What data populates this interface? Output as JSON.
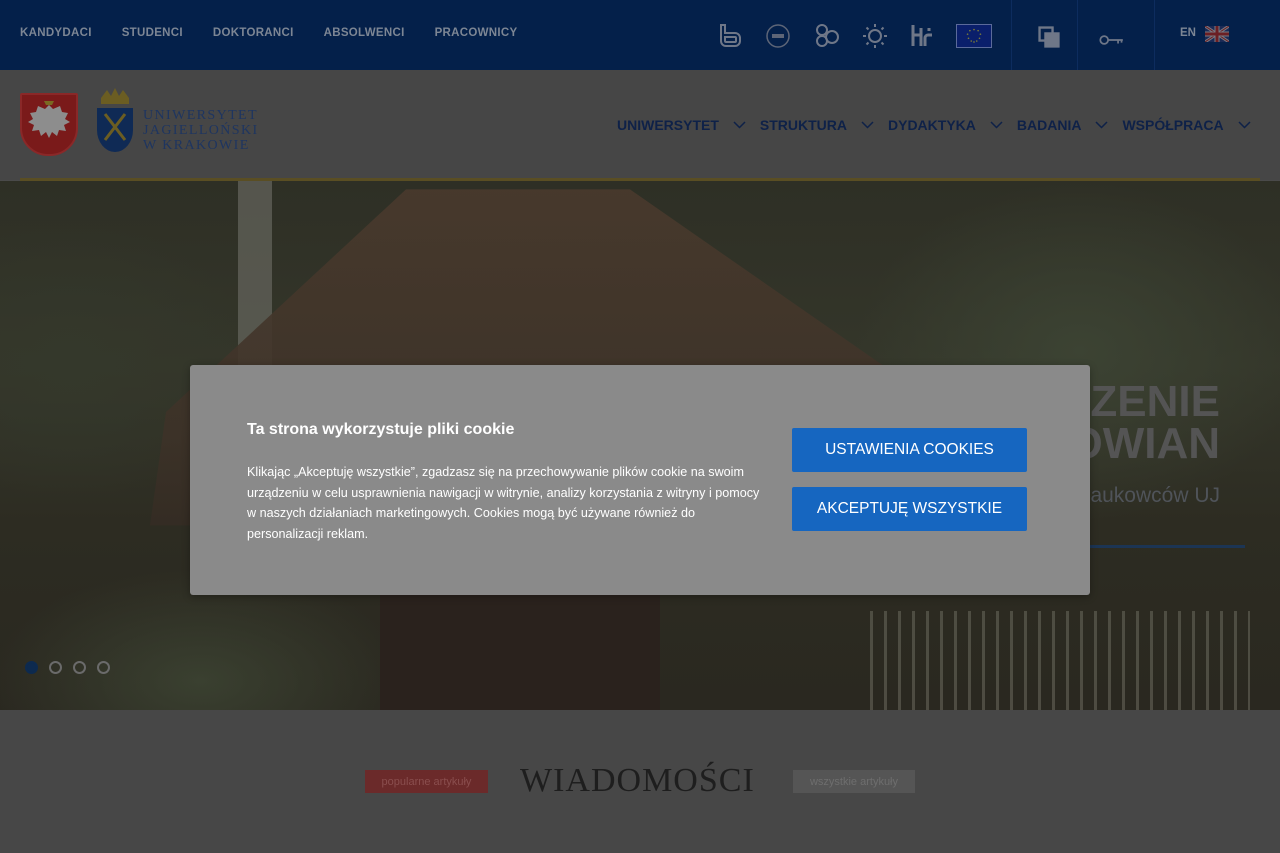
{
  "topbar": {
    "links": [
      "KANDYDACI",
      "STUDENCI",
      "DOKTORANCI",
      "ABSOLWENCI",
      "PRACOWNICY"
    ],
    "language": "EN",
    "icons": [
      "accessibility-b-icon",
      "badge-icon",
      "groups-icon",
      "sun-icon",
      "hr-icon",
      "eu-flag-icon",
      "windows-icon",
      "key-icon",
      "uk-flag-icon"
    ]
  },
  "header": {
    "university_name": [
      "UNIWERSYTET",
      "JAGIELLOŃSKI",
      "W KRAKOWIE"
    ],
    "nav": [
      "UNIWERSYTET",
      "STRUKTURA",
      "DYDAKTYKA",
      "BADANIA",
      "WSPÓŁPRACA"
    ]
  },
  "hero": {
    "title_line1": "NOWE SPOJRZENIE",
    "title_line2": "NA EKONOMIĘ PRASŁOWIAN",
    "subtitle": "…em naukowców UJ",
    "slides": 4,
    "active_slide": 1
  },
  "news": {
    "title": "WIADOMOŚCI",
    "popular_label": "popularne artykuły",
    "all_label": "wszystkie artykuły"
  },
  "cookie": {
    "title": "Ta strona wykorzystuje pliki cookie",
    "text": "Klikając „Akceptuję wszystkie”, zgadzasz się na przechowywanie plików cookie na swoim urządzeniu w celu usprawnienia nawigacji w witrynie, analizy korzystania z witryny i pomocy w naszych działaniach marketingowych. Cookies mogą być używane również do personalizacji reklam.",
    "settings_button": "USTAWIENIA COOKIES",
    "accept_button": "AKCEPTUJĘ WSZYSTKIE"
  },
  "colors": {
    "topbar": "#04204a",
    "cookie_button": "#1666c0",
    "overlay": "#4a4a4a"
  }
}
